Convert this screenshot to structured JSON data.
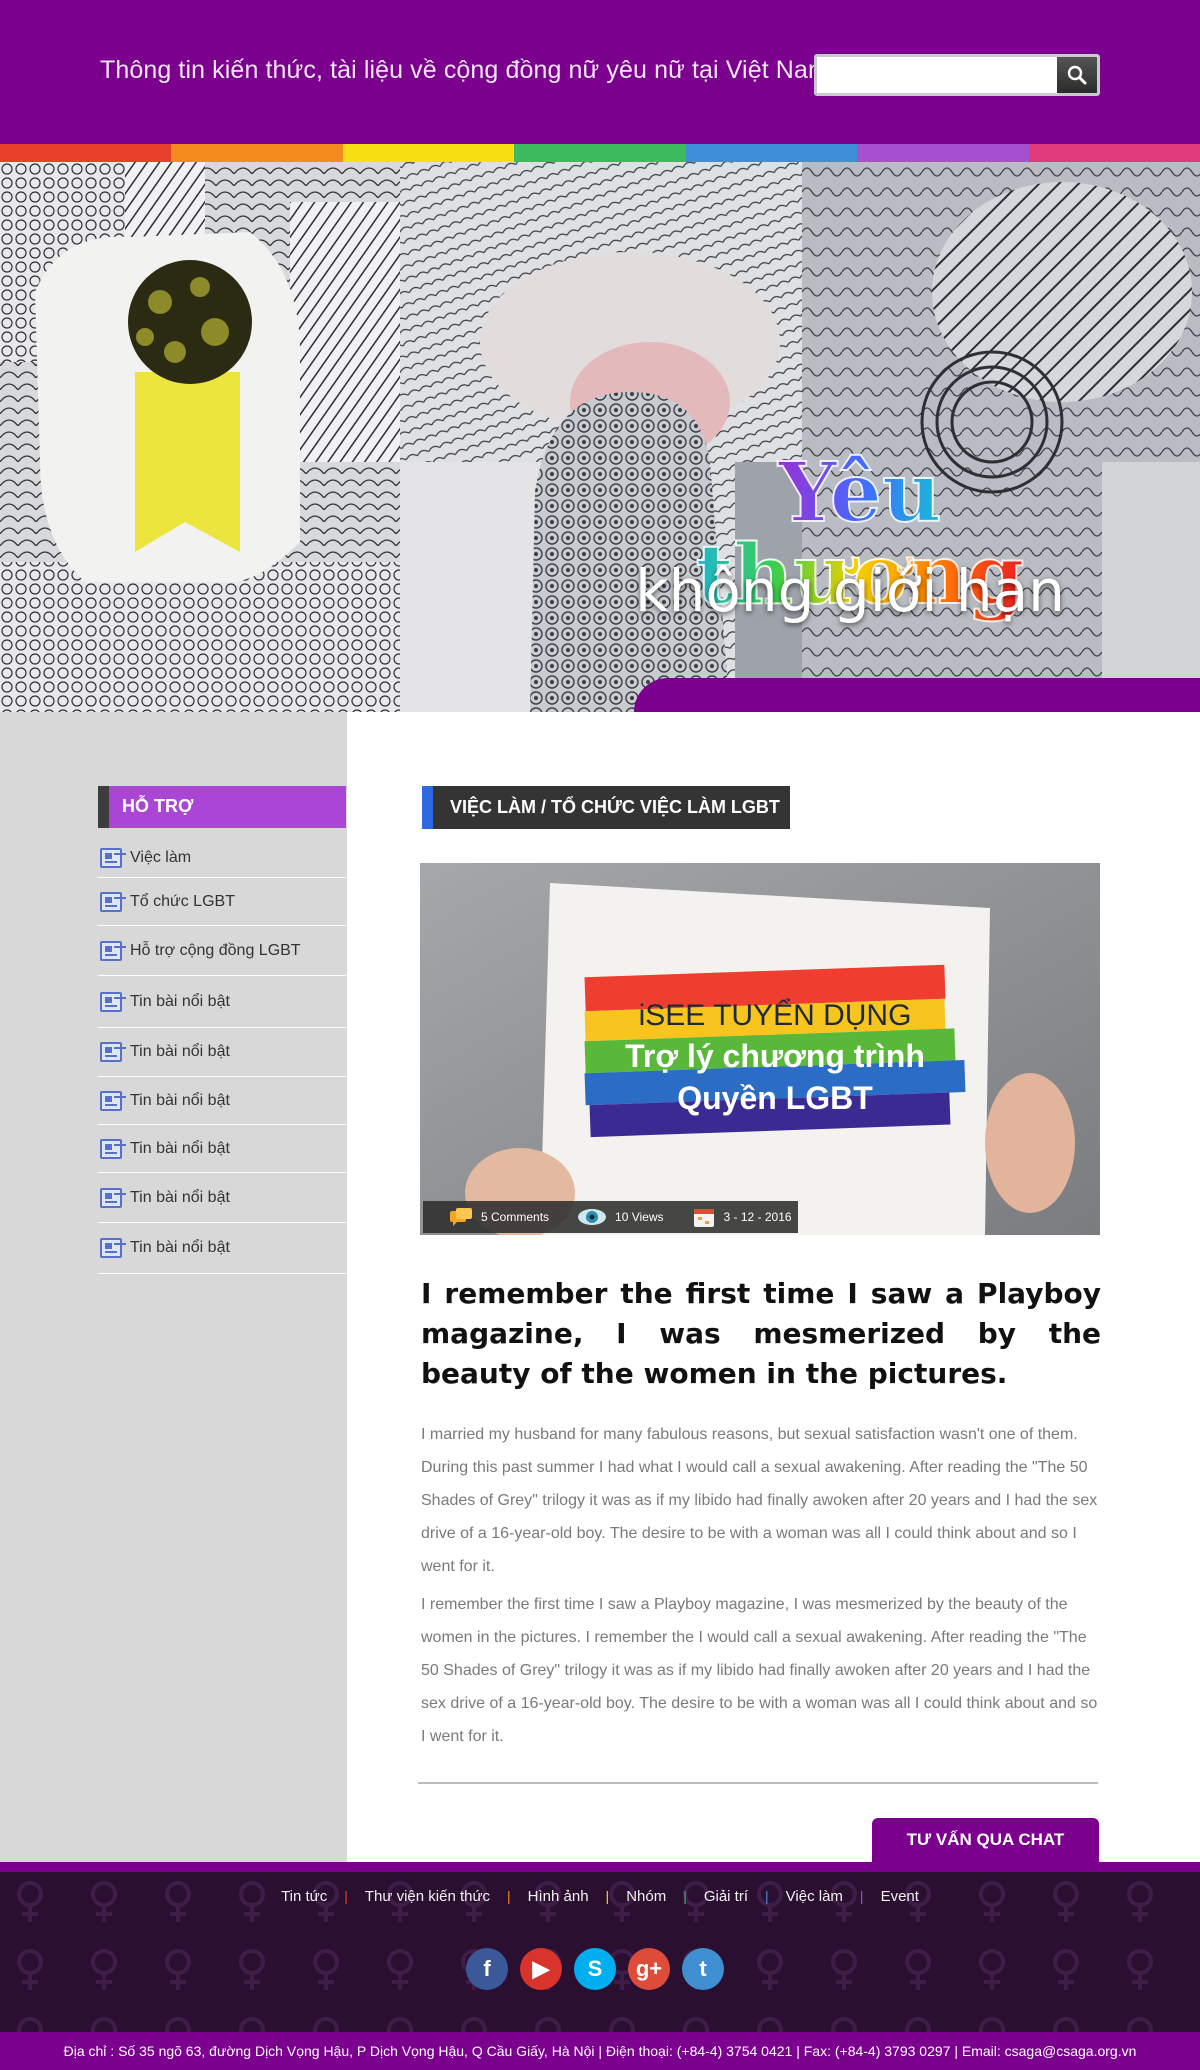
{
  "header": {
    "tagline": "Thông tin kiến thức, tài liệu về cộng đồng nữ yêu nữ tại Việt Nam",
    "search": {
      "placeholder": ""
    },
    "colors": {
      "brand": "#7b008d"
    }
  },
  "rainbow": [
    "#e8402a",
    "#f58a1f",
    "#f6df13",
    "#3dba5e",
    "#3d8fd9",
    "#a650cf",
    "#e13a7a"
  ],
  "banner": {
    "title": "Yêu thương",
    "subtitle": "không giới hạn"
  },
  "sidebar": {
    "heading": "HỖ TRỢ",
    "items": [
      {
        "label": "Việc làm"
      },
      {
        "label": "Tổ chức LGBT"
      },
      {
        "label": "Hỗ trợ cộng đồng LGBT"
      },
      {
        "label": "Tin bài nổi bật"
      },
      {
        "label": "Tin bài nổi bật"
      },
      {
        "label": "Tin bài nổi bật"
      },
      {
        "label": "Tin bài nổi bật"
      },
      {
        "label": "Tin bài nổi bật"
      },
      {
        "label": "Tin bài nổi bật"
      }
    ]
  },
  "main": {
    "category": "VIỆC LÀM / TỔ CHỨC VIỆC LÀM LGBT",
    "image_text": {
      "line1": "iSEE TUYỂN DỤNG",
      "line2": "Trợ lý chương trình",
      "line3": "Quyền LGBT"
    },
    "meta": {
      "comments": "5 Comments",
      "views": "10 Views",
      "date": "3 - 12 - 2016"
    },
    "title": "I remember the first time I saw a Playboy magazine, I was mesmerized by the beauty of the women in the pictures.",
    "paragraphs": [
      "I married my husband for many fabulous reasons, but sexual satisfaction wasn't one of them. During this past summer I had what I would call a sexual awakening. After reading the \"The 50 Shades of Grey\" trilogy it was as if my libido had finally awoken after 20 years and I had the sex drive of a 16-year-old boy. The desire to be with a woman was all I could think about and so I went for it.",
      "I remember the first time I saw a Playboy magazine, I was mesmerized by the beauty of the women in the pictures. I remember the I would call a sexual awakening. After reading the \"The 50 Shades of Grey\" trilogy it was as if my libido had finally awoken after 20 years and I had the sex drive of a 16-year-old boy. The desire to be with a woman was all I could think about and so I went for it."
    ],
    "chat_button": "TƯ VẤN QUA CHAT"
  },
  "footer": {
    "nav": [
      {
        "label": "Tin tức"
      },
      {
        "label": "Thư viện kiến thức"
      },
      {
        "label": "Hình ảnh"
      },
      {
        "label": "Nhóm"
      },
      {
        "label": "Giải trí"
      },
      {
        "label": "Việc làm"
      },
      {
        "label": "Event"
      }
    ],
    "separator_colors": [
      "#e8402a",
      "#f58a1f",
      "#f6df13",
      "#3dba5e",
      "#3d8fd9",
      "#a650cf"
    ],
    "socials": [
      {
        "icon": "facebook-icon",
        "glyph": "f",
        "color": "#3b5998"
      },
      {
        "icon": "youtube-icon",
        "glyph": "▶",
        "color": "#d9342b"
      },
      {
        "icon": "skype-icon",
        "glyph": "S",
        "color": "#00aff0"
      },
      {
        "icon": "google-plus-icon",
        "glyph": "g+",
        "color": "#dd4b39"
      },
      {
        "icon": "twitter-icon",
        "glyph": "t",
        "color": "#3f8fd2"
      }
    ],
    "address": "Địa chỉ : Số 35 ngõ 63, đường Dịch Vọng Hậu, P Dịch Vọng Hậu, Q Cầu Giấy, Hà Nội  |  Điện thoại: (+84-4) 3754 0421  |  Fax: (+84-4) 3793 0297  |  Email: csaga@csaga.org.vn"
  }
}
